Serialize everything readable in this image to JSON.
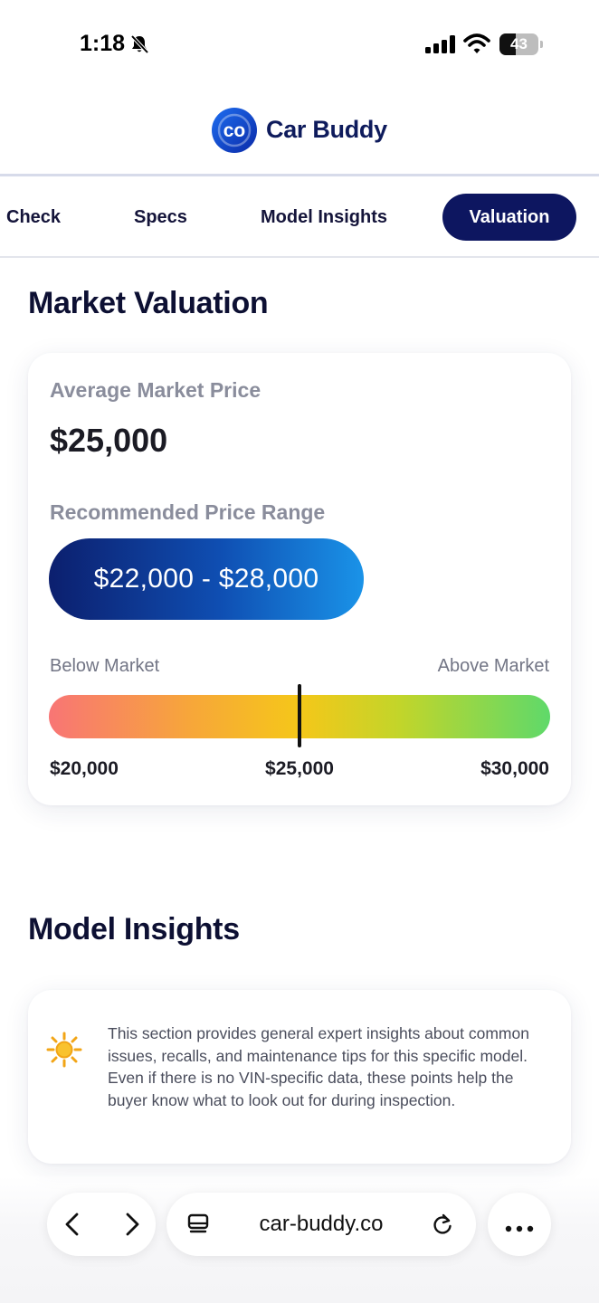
{
  "status_bar": {
    "time": "1:18",
    "battery_level": "43",
    "battery_fraction": 0.43
  },
  "header": {
    "app_name": "Car Buddy",
    "logo_letters": "co",
    "brand_color": "#0d1660"
  },
  "tabs": [
    {
      "label": "Check",
      "active": false
    },
    {
      "label": "Specs",
      "active": false
    },
    {
      "label": "Model Insights",
      "active": false
    },
    {
      "label": "Valuation",
      "active": true
    }
  ],
  "market_valuation": {
    "title": "Market Valuation",
    "average_label": "Average Market Price",
    "average_value": "$25,000",
    "range_label": "Recommended Price Range",
    "range_value": "$22,000 - $28,000",
    "scale": {
      "below_label": "Below Market",
      "above_label": "Above Market",
      "min_label": "$20,000",
      "mid_label": "$25,000",
      "max_label": "$30,000",
      "min": 20000,
      "max": 30000,
      "marker_value": 25000
    }
  },
  "model_insights": {
    "title": "Model Insights",
    "icon": "sun-icon",
    "text": "This section provides general expert insights about common issues, recalls, and maintenance tips for this specific model. Even if there is no VIN-specific data, these points help the buyer know what to look out for during inspection."
  },
  "browser": {
    "url": "car-buddy.co",
    "icons": [
      "back-arrow-icon",
      "forward-arrow-icon",
      "reader-mode-icon",
      "reload-icon",
      "more-icon"
    ]
  }
}
